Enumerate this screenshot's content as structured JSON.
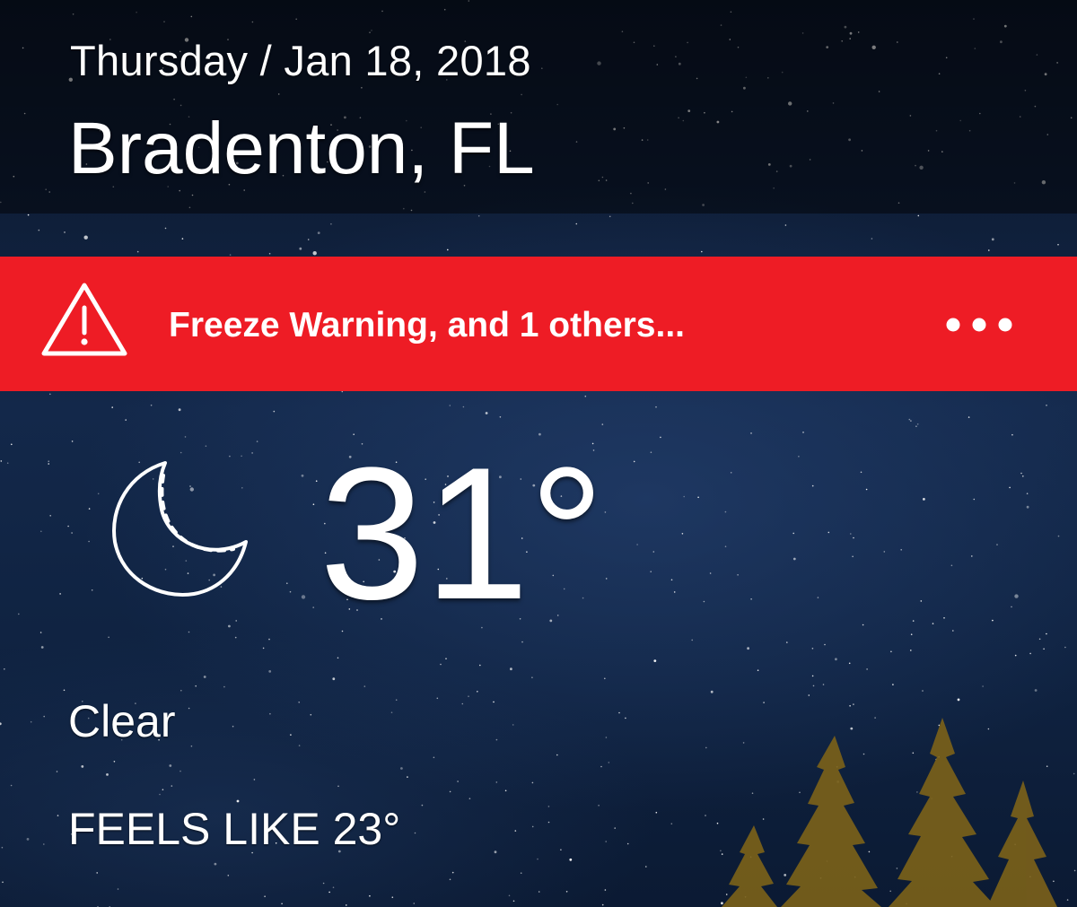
{
  "header": {
    "date": "Thursday / Jan 18, 2018",
    "location": "Bradenton, FL"
  },
  "alert": {
    "text": "Freeze Warning, and 1 others...",
    "icon": "warning-triangle-icon",
    "more_icon": "more-dots-icon",
    "color": "#ee1c25"
  },
  "current": {
    "icon": "moon-icon",
    "temperature": "31°",
    "condition": "Clear",
    "feels_like": "FEELS LIKE 23°"
  },
  "background": {
    "sky_color": "#13284a",
    "tree_color": "#8a6d1e"
  }
}
